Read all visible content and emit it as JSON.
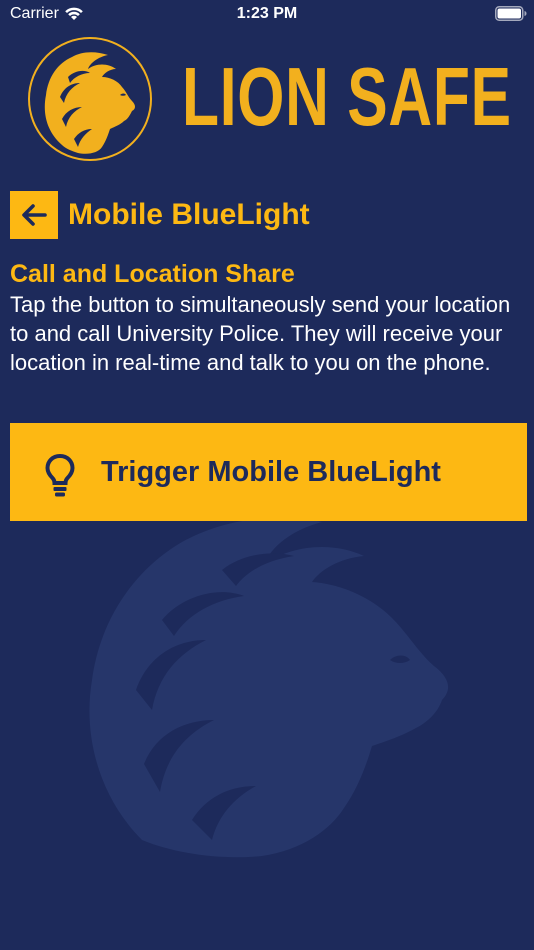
{
  "status_bar": {
    "carrier": "Carrier",
    "time": "1:23 PM"
  },
  "header": {
    "app_title": "LION SAFE",
    "logo_icon": "lion-head-icon"
  },
  "page": {
    "title": "Mobile BlueLight",
    "back_icon": "arrow-left-icon"
  },
  "section": {
    "heading": "Call and Location Share",
    "body": "Tap the button to simultaneously send your location to and call University Police. They will receive your location in real-time and talk to you on the phone."
  },
  "action": {
    "label": "Trigger Mobile BlueLight",
    "icon": "lightbulb-icon"
  },
  "colors": {
    "background": "#1d2a5b",
    "accent": "#fdb813",
    "text": "#ffffff"
  }
}
